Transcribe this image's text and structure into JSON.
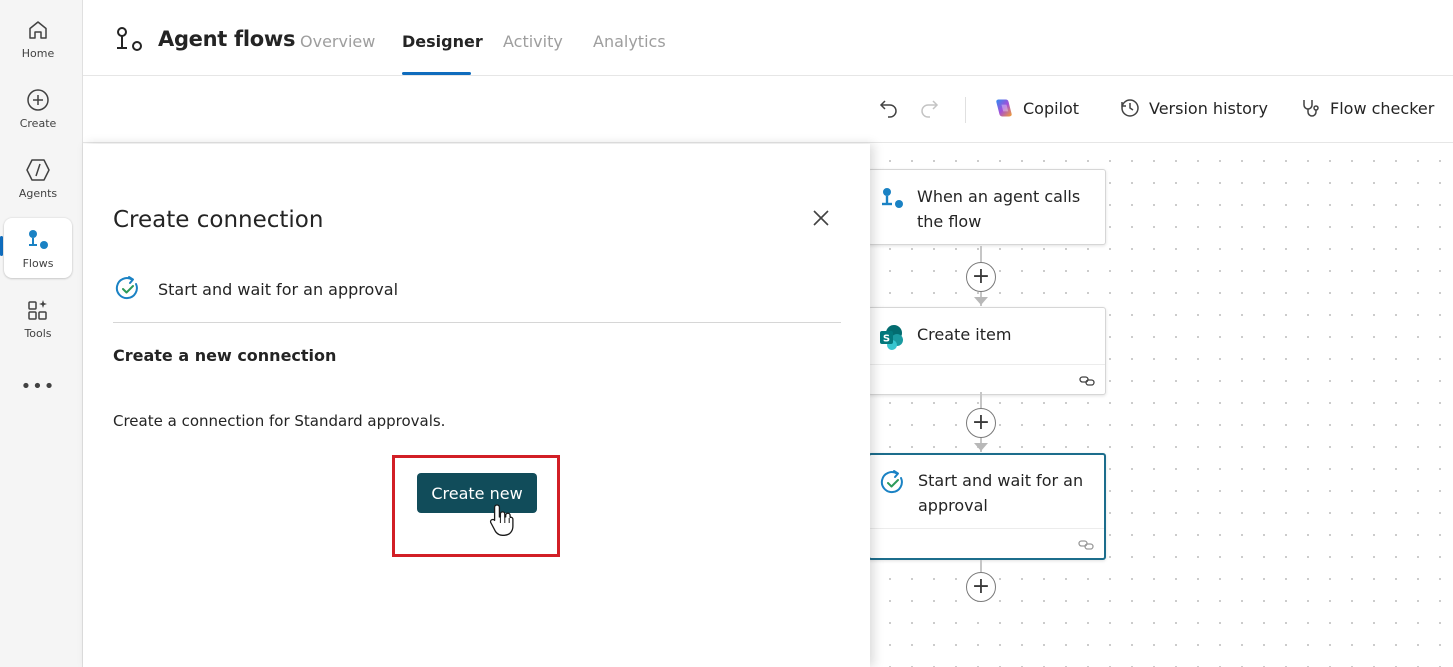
{
  "rail": {
    "items": [
      {
        "label": "Home",
        "icon": "home-icon"
      },
      {
        "label": "Create",
        "icon": "plus-circle-icon"
      },
      {
        "label": "Agents",
        "icon": "agents-icon"
      },
      {
        "label": "Flows",
        "icon": "flows-icon"
      },
      {
        "label": "Tools",
        "icon": "tools-icon"
      }
    ],
    "more": "•••",
    "active": "Flows"
  },
  "header": {
    "title": "Agent flows",
    "tabs": [
      {
        "label": "Overview"
      },
      {
        "label": "Designer"
      },
      {
        "label": "Activity"
      },
      {
        "label": "Analytics"
      }
    ],
    "active_tab": "Designer"
  },
  "toolbar": {
    "copilot": "Copilot",
    "version_history": "Version history",
    "flow_checker": "Flow checker"
  },
  "flow": {
    "nodes": [
      {
        "label": "When an agent calls the flow",
        "icon": "agent-trigger-icon"
      },
      {
        "label": "Create item",
        "icon": "sharepoint-icon"
      },
      {
        "label": "Start and wait for an approval",
        "icon": "approval-icon"
      }
    ]
  },
  "panel": {
    "title": "Create connection",
    "action_label": "Start and wait for an approval",
    "sub_heading": "Create a new connection",
    "description": "Create a connection for Standard approvals.",
    "create_button": "Create new"
  },
  "colors": {
    "accent": "#0f6cbd",
    "primary_button": "#114c5a",
    "highlight": "#d21f26",
    "selected_node_border": "#1c6d8c"
  }
}
